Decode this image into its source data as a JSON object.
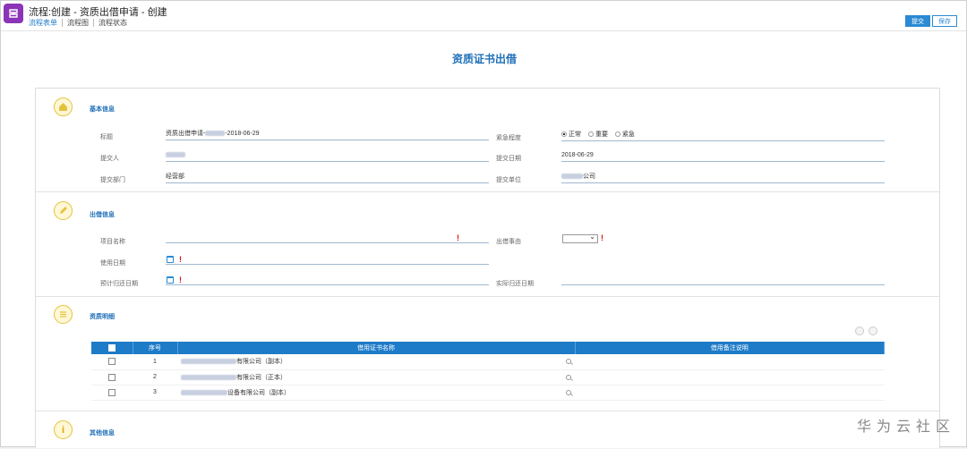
{
  "header": {
    "title": "流程:创建 - 资质出借申请 - 创建",
    "subnav": [
      "流程表单",
      "流程图",
      "流程状态"
    ],
    "submit_label": "提交",
    "save_label": "保存"
  },
  "form_title": "资质证书出借",
  "sections": {
    "basic": {
      "title": "基本信息",
      "title_label": "标题",
      "title_value_prefix": "资质出借申请-",
      "title_value_suffix": "-2018-06-29",
      "urgency_label": "紧急程度",
      "urgency_options": [
        "正常",
        "重要",
        "紧急"
      ],
      "urgency_selected": "正常",
      "applicant_label": "提交人",
      "date_label": "提交日期",
      "date_value": "2018-06-29",
      "dept_label": "提交部门",
      "dept_value": "经营部",
      "company_label": "提交单位",
      "company_value_suffix": "公司"
    },
    "lend": {
      "title": "出借信息",
      "project_label": "项目名称",
      "purpose_label": "出借事由",
      "use_date_label": "使用日期",
      "return_plan_label": "预计归还日期",
      "return_actual_label": "实际归还日期"
    },
    "detail": {
      "title": "资质明细",
      "columns": [
        "序号",
        "借用证书名称",
        "借用备注说明"
      ],
      "rows": [
        {
          "no": "1",
          "name_suffix": "有限公司（副本）"
        },
        {
          "no": "2",
          "name_suffix": "有限公司（正本）"
        },
        {
          "no": "3",
          "name_suffix": "设备有限公司（副本）"
        }
      ]
    },
    "other": {
      "title": "其他信息"
    }
  },
  "watermark": "华为云社区",
  "colors": {
    "accent": "#1e7bc8",
    "logo": "#8b34b8",
    "required": "#e01010"
  }
}
